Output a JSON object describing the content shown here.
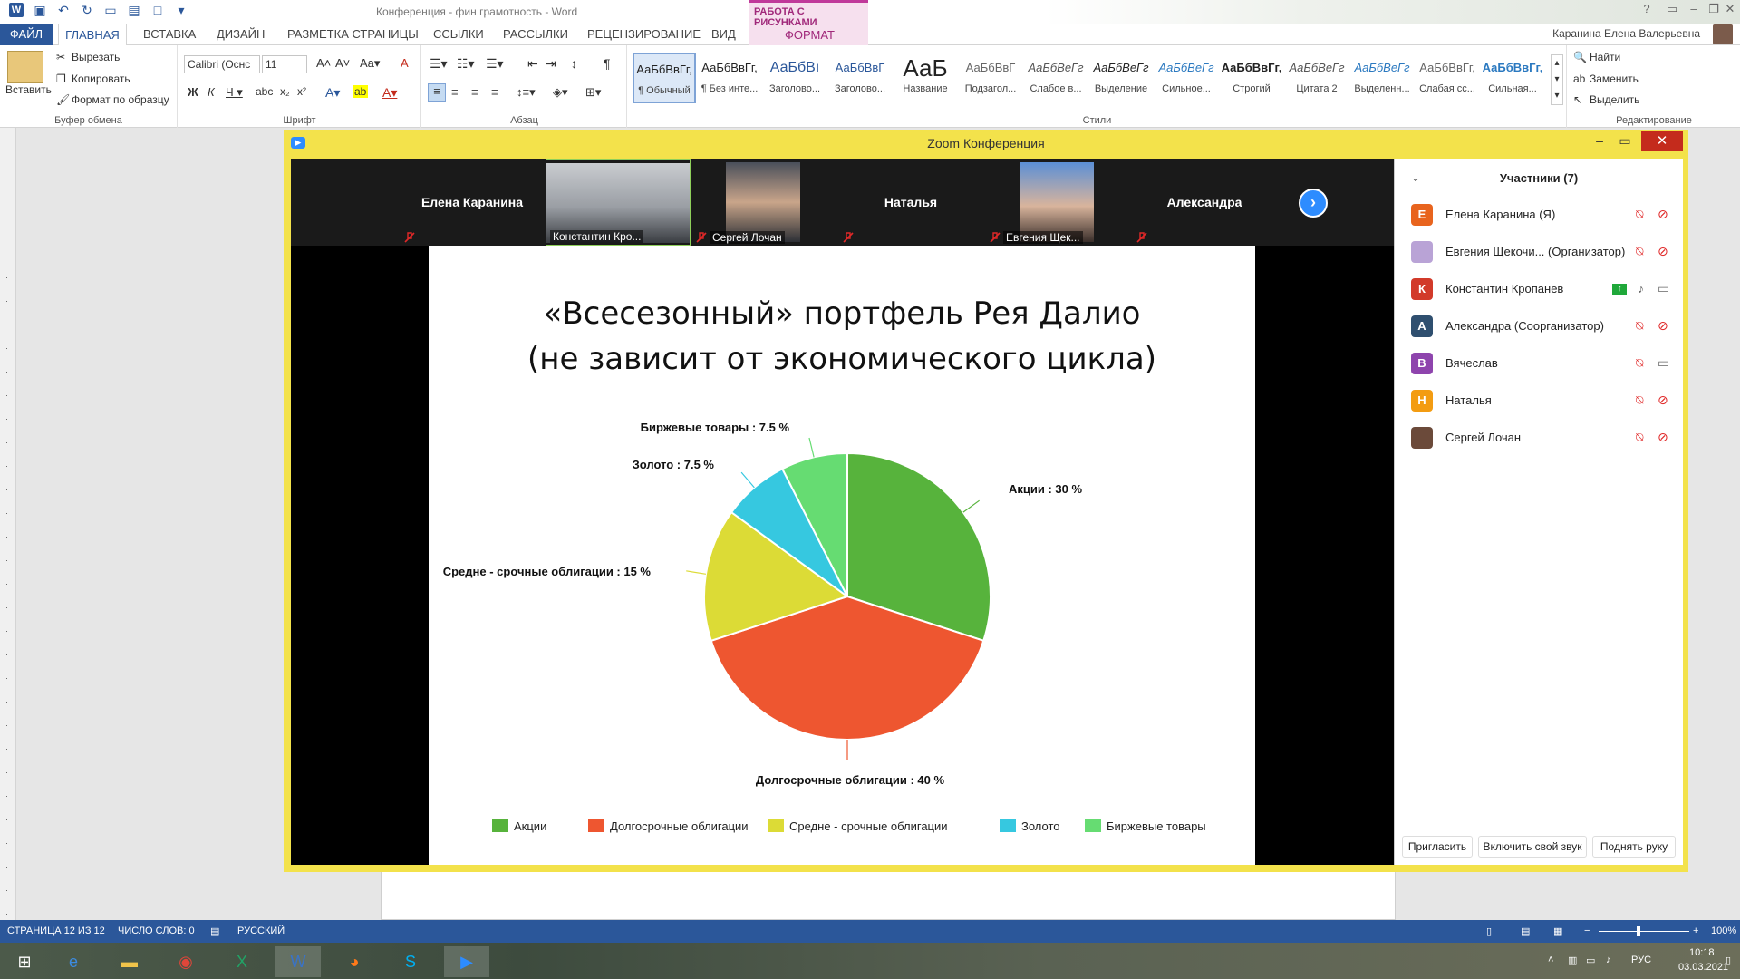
{
  "word": {
    "doc_title": "Конференция - фин грамотность - Word",
    "tabs": [
      "ФАЙЛ",
      "ГЛАВНАЯ",
      "ВСТАВКА",
      "ДИЗАЙН",
      "РАЗМЕТКА СТРАНИЦЫ",
      "ССЫЛКИ",
      "РАССЫЛКИ",
      "РЕЦЕНЗИРОВАНИЕ",
      "ВИД"
    ],
    "context_group": "РАБОТА С РИСУНКАМИ",
    "context_tab": "ФОРМАТ",
    "user": "Каранина Елена Валерьевна",
    "clipboard": {
      "paste": "Вставить",
      "cut": "Вырезать",
      "copy": "Копировать",
      "format_painter": "Формат по образцу",
      "label": "Буфер обмена"
    },
    "font": {
      "name": "Calibri (Оснс",
      "size": "11",
      "label": "Шрифт"
    },
    "paragraph": {
      "label": "Абзац"
    },
    "styles": {
      "label": "Стили",
      "items": [
        {
          "sample": "АаБбВвГг,",
          "name": "¶ Обычный"
        },
        {
          "sample": "АаБбВвГг,",
          "name": "¶ Без инте..."
        },
        {
          "sample": "АаБбВı",
          "name": "Заголово..."
        },
        {
          "sample": "АаБбВвГ",
          "name": "Заголово..."
        },
        {
          "sample": "АаБ",
          "name": "Название"
        },
        {
          "sample": "АаБбВвГ",
          "name": "Подзагол..."
        },
        {
          "sample": "АаБбВеГг",
          "name": "Слабое в..."
        },
        {
          "sample": "АаБбВеГг",
          "name": "Выделение"
        },
        {
          "sample": "АаБбВеГг",
          "name": "Сильное..."
        },
        {
          "sample": "АаБбВвГг,",
          "name": "Строгий"
        },
        {
          "sample": "АаБбВеГг",
          "name": "Цитата 2"
        },
        {
          "sample": "АаБбВеГг",
          "name": "Выделенн..."
        },
        {
          "sample": "АаБбВвГг,",
          "name": "Слабая сс..."
        },
        {
          "sample": "АаБбВвГг,",
          "name": "Сильная..."
        }
      ]
    },
    "editing": {
      "find": "Найти",
      "replace": "Заменить",
      "select": "Выделить",
      "label": "Редактирование"
    },
    "status": {
      "page": "СТРАНИЦА 12 ИЗ 12",
      "words": "ЧИСЛО СЛОВ: 0",
      "lang": "РУССКИЙ",
      "zoom": "100%"
    }
  },
  "taskbar": {
    "lang": "РУС",
    "time": "10:18",
    "date": "03.03.2021"
  },
  "zoom": {
    "title": "Zoom Конференция",
    "thumbnails": [
      {
        "name": "Елена Каранина",
        "label": ""
      },
      {
        "name": "",
        "label": "Константин Кро..."
      },
      {
        "name": "",
        "label": "Сергей Лочан"
      },
      {
        "name": "Наталья",
        "label": ""
      },
      {
        "name": "",
        "label": "Евгения Щек..."
      },
      {
        "name": "Александра",
        "label": ""
      }
    ],
    "participants_header": "Участники (7)",
    "participants": [
      {
        "initial": "Е",
        "color": "#e8641e",
        "name": "Елена Каранина (Я)"
      },
      {
        "initial": "",
        "color": "#8a6bb8",
        "name": "Евгения Щекочи... (Организатор)"
      },
      {
        "initial": "К",
        "color": "#d23a2a",
        "name": "Константин Кропанев"
      },
      {
        "initial": "А",
        "color": "#2f4f6f",
        "name": "Александра (Соорганизатор)"
      },
      {
        "initial": "В",
        "color": "#8e44ad",
        "name": "Вячеслав"
      },
      {
        "initial": "Н",
        "color": "#f39c12",
        "name": "Наталья"
      },
      {
        "initial": "",
        "color": "#6b4a3a",
        "name": "Сергей Лочан"
      }
    ],
    "buttons": {
      "invite": "Пригласить",
      "unmute": "Включить свой звук",
      "raise": "Поднять руку"
    }
  },
  "slide": {
    "title_line1": "«Всесезонный» портфель Рея Далио",
    "title_line2": "(не зависит от экономического цикла)"
  },
  "chart_data": {
    "type": "pie",
    "categories": [
      "Акции",
      "Долгосрочные облигации",
      "Средне - срочные облигации",
      "Золото",
      "Биржевые товары"
    ],
    "values": [
      30,
      40,
      15,
      7.5,
      7.5
    ],
    "labels": [
      "Акции  : 30 %",
      "Долгосрочные облигации : 40 %",
      "Средне - срочные облигации : 15 %",
      "Золото : 7.5 %",
      "Биржевые товары : 7.5 %"
    ],
    "colors": [
      "#57b33c",
      "#ee5630",
      "#dcdb36",
      "#36c8e0",
      "#66dc72"
    ],
    "legend": "bottom"
  }
}
